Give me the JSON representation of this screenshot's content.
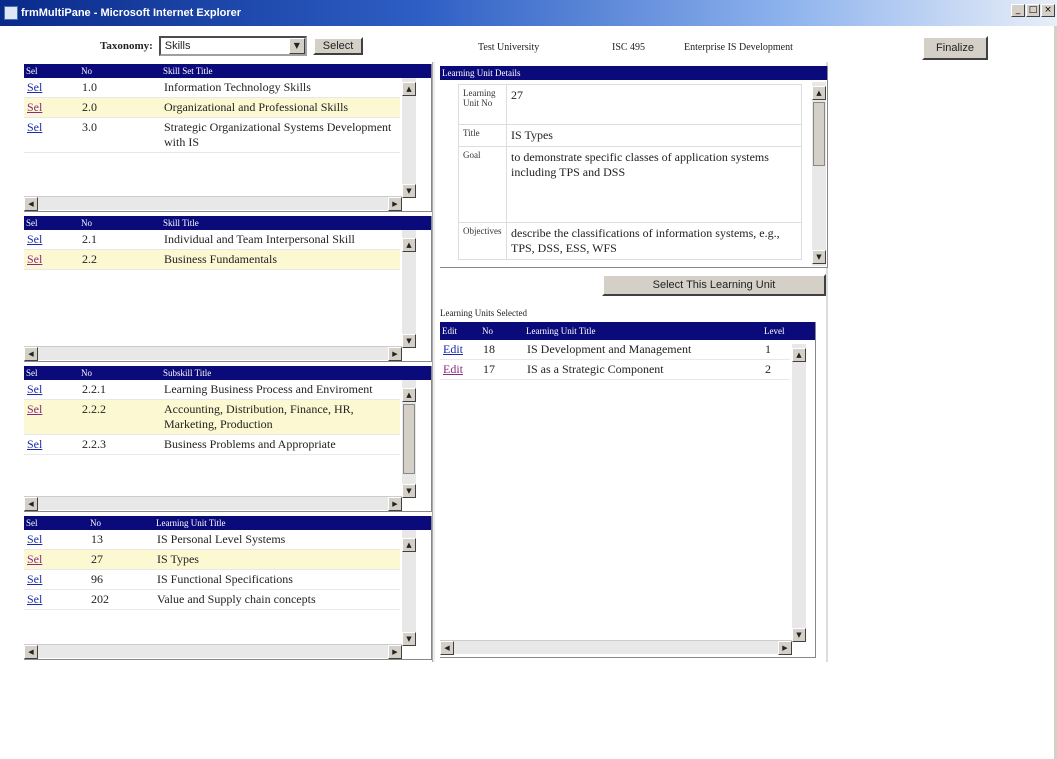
{
  "window": {
    "title": "frmMultiPane - Microsoft Internet Explorer"
  },
  "header": {
    "taxonomy_label": "Taxonomy:",
    "taxonomy_value": "Skills",
    "select_button": "Select",
    "university": "Test University",
    "course_code": "ISC 495",
    "course_name": "Enterprise IS Development",
    "finalize_button": "Finalize"
  },
  "skill_sets": {
    "columns": [
      "Sel",
      "No",
      "Skill Set Title"
    ],
    "rows": [
      {
        "sel": "Sel",
        "no": "1.0",
        "title": "Information Technology Skills"
      },
      {
        "sel": "Sel",
        "no": "2.0",
        "title": "Organizational and Professional Skills"
      },
      {
        "sel": "Sel",
        "no": "3.0",
        "title": "Strategic Organizational Systems Development with IS"
      }
    ]
  },
  "skills": {
    "columns": [
      "Sel",
      "No",
      "Skill Title"
    ],
    "rows": [
      {
        "sel": "Sel",
        "no": "2.1",
        "title": "Individual and Team Interpersonal Skill"
      },
      {
        "sel": "Sel",
        "no": "2.2",
        "title": "Business Fundamentals"
      }
    ]
  },
  "subskills": {
    "columns": [
      "Sel",
      "No",
      "Subskill Title"
    ],
    "rows": [
      {
        "sel": "Sel",
        "no": "2.2.1",
        "title": "Learning Business Process and Enviroment"
      },
      {
        "sel": "Sel",
        "no": "2.2.2",
        "title": "Accounting, Distribution, Finance, HR, Marketing, Production"
      },
      {
        "sel": "Sel",
        "no": "2.2.3",
        "title": "Business Problems and Appropriate"
      }
    ]
  },
  "learning_units": {
    "columns": [
      "Sel",
      "No",
      "Learning Unit Title"
    ],
    "rows": [
      {
        "sel": "Sel",
        "no": "13",
        "title": "IS Personal Level Systems"
      },
      {
        "sel": "Sel",
        "no": "27",
        "title": "IS Types"
      },
      {
        "sel": "Sel",
        "no": "96",
        "title": "IS Functional Specifications"
      },
      {
        "sel": "Sel",
        "no": "202",
        "title": "Value and Supply chain concepts"
      }
    ]
  },
  "details": {
    "header": "Learning Unit Details",
    "unit_no_label": "Learning Unit No",
    "unit_no": "27",
    "title_label": "Title",
    "title": "IS Types",
    "goal_label": "Goal",
    "goal": "to demonstrate specific classes of application systems including TPS and DSS",
    "objectives_label": "Objectives",
    "objectives": "describe the classifications of information systems, e.g., TPS, DSS, ESS, WFS",
    "select_unit_button": "Select This Learning Unit"
  },
  "selected_units": {
    "caption": "Learning Units Selected",
    "columns": [
      "Edit",
      "No",
      "Learning Unit Title",
      "Level"
    ],
    "rows": [
      {
        "edit": "Edit",
        "no": "18",
        "title": "IS Development and Management",
        "level": "1"
      },
      {
        "edit": "Edit",
        "no": "17",
        "title": "IS as a Strategic Component",
        "level": "2"
      }
    ]
  }
}
